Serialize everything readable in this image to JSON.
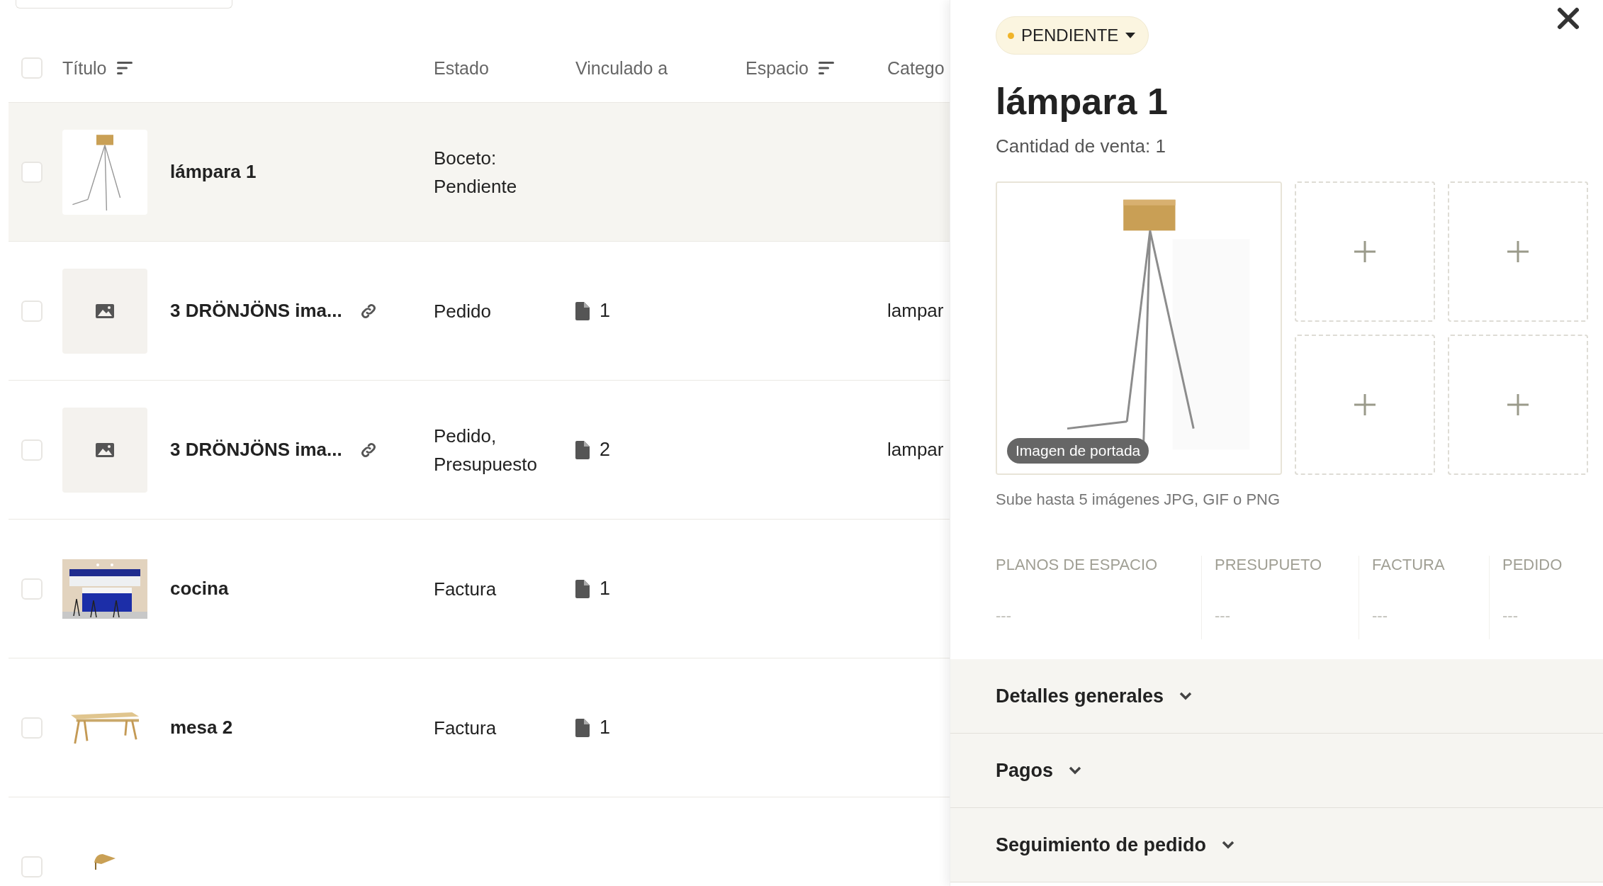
{
  "table": {
    "header_checkbox": {
      "checked": false
    },
    "columns": [
      {
        "label": "Título",
        "sortable": true
      },
      {
        "label": "Estado",
        "sortable": false
      },
      {
        "label": "Vinculado a",
        "sortable": false
      },
      {
        "label": "Espacio",
        "sortable": true
      },
      {
        "label": "Catego",
        "sortable": false
      }
    ],
    "rows": [
      {
        "checked": false,
        "selected": true,
        "title": "lámpara 1",
        "linked_icon": false,
        "status": "Boceto:\nPendiente"
      },
      {
        "checked": false,
        "selected": false,
        "thumbnail": {
          "kind": "placeholder"
        },
        "title": "3 DRÖNJÖNS ima...",
        "linked_icon": true,
        "status": "Pedido",
        "docs": "1",
        "category": "lampar"
      },
      {
        "checked": false,
        "selected": false,
        "thumbnail": {
          "kind": "placeholder"
        },
        "title": "3 DRÖNJÖNS ima...",
        "linked_icon": true,
        "status": "Pedido,\nPresupuesto",
        "docs": "2",
        "category": "lampar"
      },
      {
        "checked": false,
        "selected": false,
        "title": "cocina",
        "linked_icon": false,
        "status": "Factura",
        "docs": "1"
      },
      {
        "checked": false,
        "selected": false,
        "title": "mesa 2",
        "linked_icon": false,
        "status": "Factura",
        "docs": "1"
      },
      {
        "checked": false,
        "selected": false
      }
    ]
  },
  "panel": {
    "status_badge": {
      "label": "PENDIENTE"
    },
    "title": "lámpara 1",
    "subtitle": "Cantidad de venta: 1",
    "gallery": {
      "cover_label": "Imagen de portada"
    },
    "gallery_hint": "Sube hasta 5 imágenes JPG, GIF o PNG",
    "documents": [
      {
        "label": "PLANOS DE ESPACIO",
        "value": "---"
      },
      {
        "label": "PRESUPUETO",
        "value": "---"
      },
      {
        "label": "FACTURA",
        "value": "---"
      },
      {
        "label": "PEDIDO",
        "value": "---"
      }
    ],
    "sections": [
      {
        "label": "Detalles generales",
        "expanded": false
      },
      {
        "label": "Pagos",
        "expanded": false
      },
      {
        "label": "Seguimiento de pedido",
        "expanded": false
      }
    ]
  }
}
